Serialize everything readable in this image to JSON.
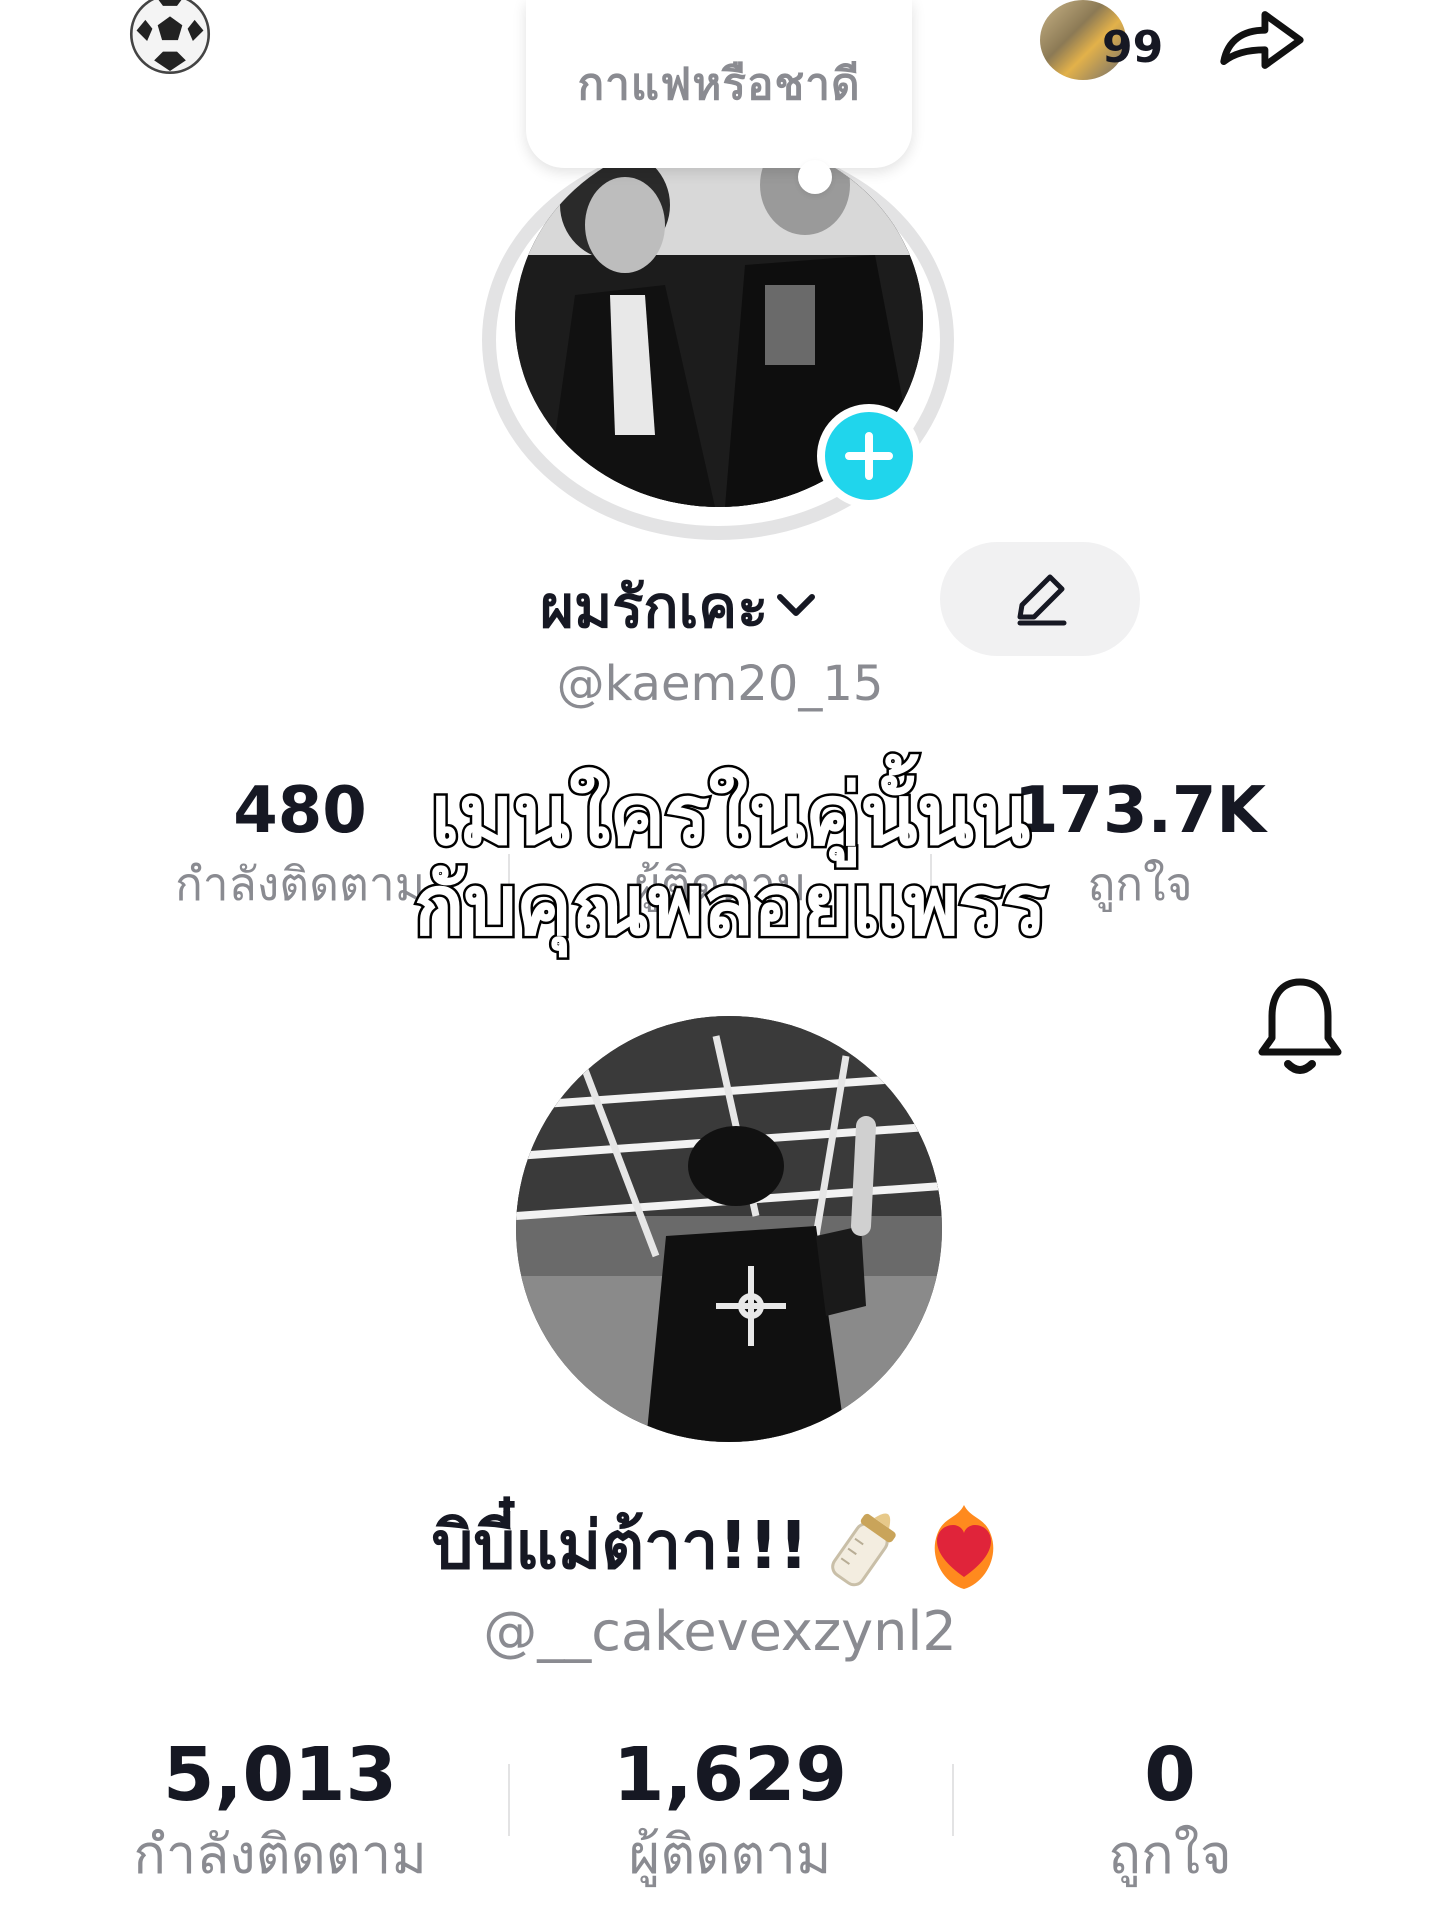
{
  "top_bar": {
    "soccer_icon": "soccer-ball-icon",
    "friends_count": "99",
    "share_icon": "share-arrow-icon"
  },
  "note": {
    "text": "กาแฟหรือชาดี"
  },
  "profile_1": {
    "display_name": "ผมรักเคะ",
    "username": "@kaem20_15",
    "stats": [
      {
        "value": "480",
        "label": "กำลังติดตาม"
      },
      {
        "value": "",
        "label": "ผู้ติดตาม"
      },
      {
        "value": "173.7K",
        "label": "ถูกใจ"
      }
    ]
  },
  "overlay_caption": {
    "line1": "เมนใครในคู่นั้นน",
    "line2": "กับคุณพลอยแพรร"
  },
  "profile_2": {
    "display_name": "บิบี๋แม่ต้าา!!!",
    "username": "@__cakevexzynl2",
    "stats": [
      {
        "value": "5,013",
        "label": "กำลังติดตาม"
      },
      {
        "value": "1,629",
        "label": "ผู้ติดตาม"
      },
      {
        "value": "0",
        "label": "ถูกใจ"
      }
    ]
  },
  "colors": {
    "accent": "#20d5ec",
    "muted": "#8a8b91",
    "text": "#161823"
  }
}
